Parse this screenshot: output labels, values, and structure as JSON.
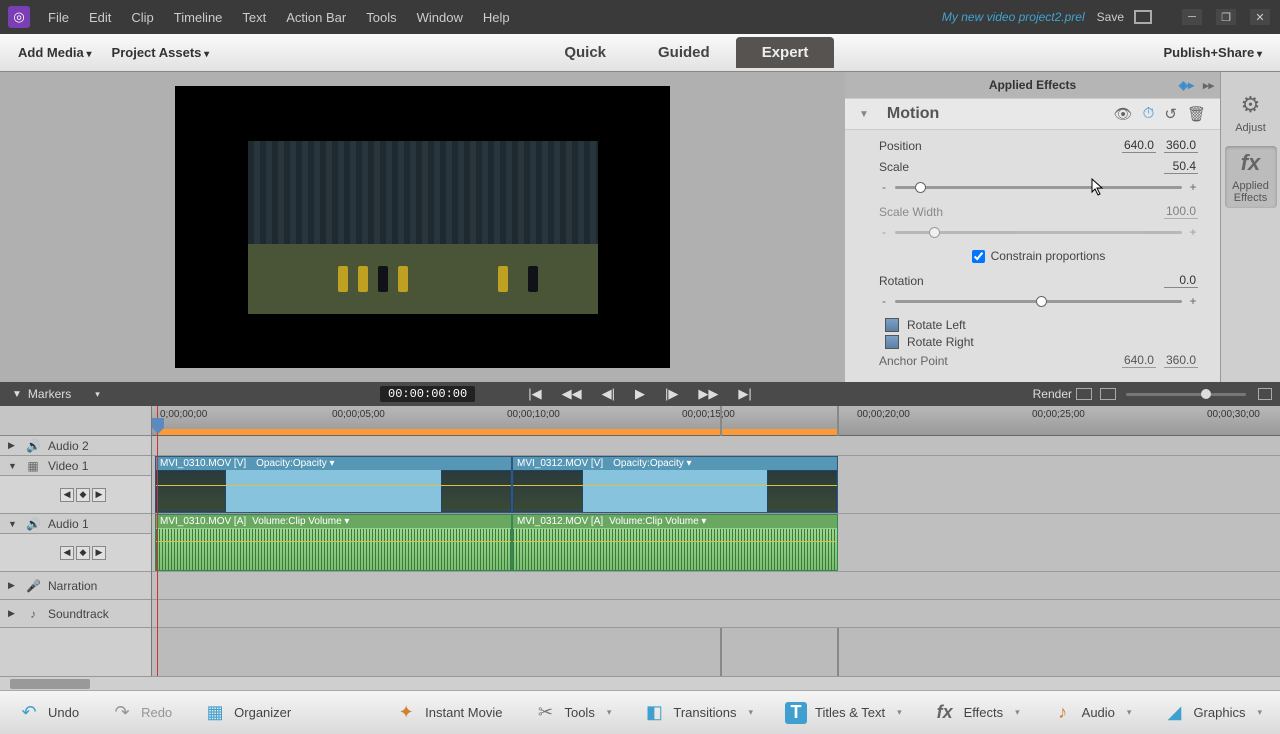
{
  "app": {
    "project_title": "My new video project2.prel",
    "save": "Save"
  },
  "menu": {
    "file": "File",
    "edit": "Edit",
    "clip": "Clip",
    "timeline": "Timeline",
    "text": "Text",
    "actionbar": "Action Bar",
    "tools": "Tools",
    "window": "Window",
    "help": "Help"
  },
  "modebar": {
    "add_media": "Add Media",
    "project_assets": "Project Assets",
    "publish": "Publish+Share"
  },
  "tabs": {
    "quick": "Quick",
    "guided": "Guided",
    "expert": "Expert"
  },
  "panel": {
    "title": "Applied Effects",
    "motion": "Motion",
    "position_label": "Position",
    "pos_x": "640.0",
    "pos_y": "360.0",
    "scale_label": "Scale",
    "scale_val": "50.4",
    "scalew_label": "Scale Width",
    "scalew_val": "100.0",
    "constrain": "Constrain proportions",
    "rotation_label": "Rotation",
    "rotation_val": "0.0",
    "rotate_left": "Rotate Left",
    "rotate_right": "Rotate Right",
    "anchor_label": "Anchor Point",
    "anchor_x": "640.0",
    "anchor_y": "360.0"
  },
  "right_tabs": {
    "adjust": "Adjust",
    "applied": "Applied Effects"
  },
  "transport": {
    "markers": "Markers",
    "timecode": "00:00:00:00",
    "render": "Render"
  },
  "ruler": {
    "t0": "0;00;00;00",
    "t5": "00;00;05;00",
    "t10": "00;00;10;00",
    "t15": "00;00;15;00",
    "t20": "00;00;20;00",
    "t25": "00;00;25;00",
    "t30": "00;00;30;00"
  },
  "tracks": {
    "audio2": "Audio 2",
    "video1": "Video 1",
    "audio1": "Audio 1",
    "narration": "Narration",
    "soundtrack": "Soundtrack"
  },
  "clips": {
    "v1": "MVI_0310.MOV [V]",
    "v1o": "Opacity:Opacity ▾",
    "v2": "MVI_0312.MOV [V]",
    "v2o": "Opacity:Opacity ▾",
    "a1": "MVI_0310.MOV [A]",
    "a1v": "Volume:Clip Volume ▾",
    "a2": "MVI_0312.MOV [A]",
    "a2v": "Volume:Clip Volume ▾"
  },
  "bottom": {
    "undo": "Undo",
    "redo": "Redo",
    "organizer": "Organizer",
    "instant": "Instant Movie",
    "tools": "Tools",
    "transitions": "Transitions",
    "titles": "Titles & Text",
    "effects": "Effects",
    "audio": "Audio",
    "graphics": "Graphics"
  }
}
